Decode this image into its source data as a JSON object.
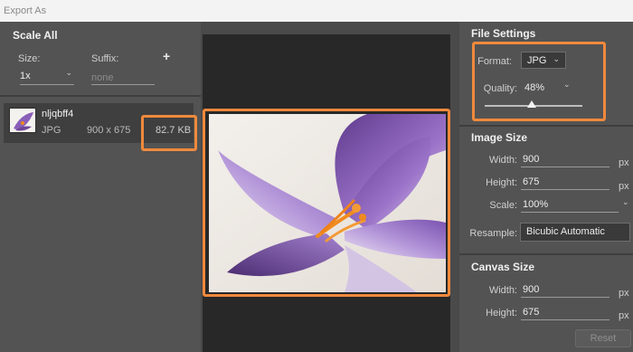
{
  "window": {
    "title": "Export As"
  },
  "scale_all": {
    "header": "Scale All",
    "size_label": "Size:",
    "suffix_label": "Suffix:",
    "add_label": "+",
    "size_value": "1x",
    "suffix_placeholder": "none"
  },
  "file": {
    "name": "nljqbff4",
    "type": "JPG",
    "dimensions": "900 x 675",
    "size": "82.7 KB"
  },
  "file_settings": {
    "header": "File Settings",
    "format_label": "Format:",
    "format_value": "JPG",
    "quality_label": "Quality:",
    "quality_value": "48%",
    "quality_level": 0.48
  },
  "image_size": {
    "header": "Image Size",
    "width_label": "Width:",
    "width_value": "900",
    "height_label": "Height:",
    "height_value": "675",
    "scale_label": "Scale:",
    "scale_value": "100%",
    "resample_label": "Resample:",
    "resample_value": "Bicubic Automatic",
    "unit": "px"
  },
  "canvas_size": {
    "header": "Canvas Size",
    "width_label": "Width:",
    "width_value": "900",
    "height_label": "Height:",
    "height_value": "675",
    "unit": "px",
    "reset_label": "Reset"
  },
  "colors": {
    "highlight": "#f0893c",
    "flower": "#8a5fb8",
    "stamen": "#f08a1e"
  }
}
